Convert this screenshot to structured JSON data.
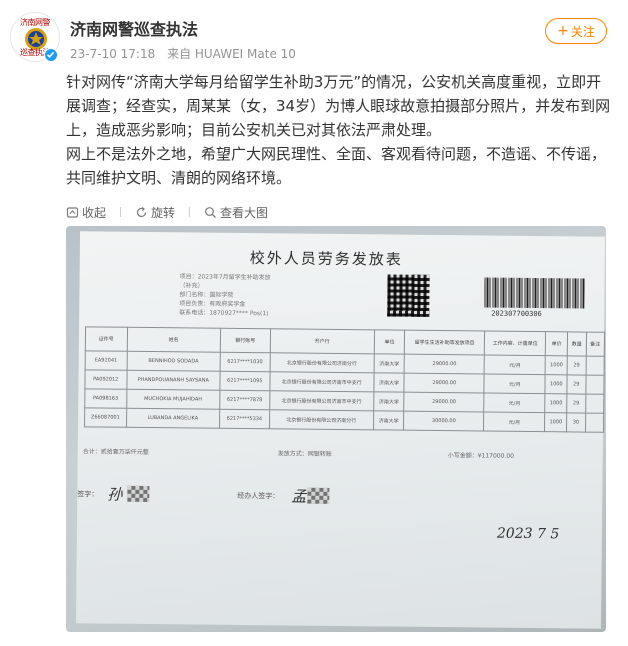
{
  "account": {
    "name": "济南网警巡查执法",
    "avatar_text_top": "济南网警",
    "avatar_text_bottom": "巡查执法",
    "timestamp": "23-7-10 17:18",
    "source": "来自 HUAWEI Mate 10",
    "follow_label": "关注",
    "verify_color": "#1e9cf0"
  },
  "post": {
    "paragraph1": "针对网传“济南大学每月给留学生补助3万元”的情况，公安机关高度重视，立即开展调查；经查实，周某某（女，34岁）为博人眼球故意拍摄部分照片，并发布到网上，造成恶劣影响；目前公安机关已对其依法严肃处理。",
    "paragraph2": "网上不是法外之地，希望广大网民理性、全面、客观看待问题，不造谣、不传谣，共同维护文明、清朗的网络环境。"
  },
  "image_toolbar": {
    "collect": "收起",
    "rotate": "旋转",
    "view_large": "查看大图"
  },
  "photo": {
    "doc_title": "校外人员劳务发放表",
    "info_lines": [
      "项目：2023年7月留学生补助发放",
      "（补充）",
      "部门名称：国际学院",
      "项目负责：有政府奖学金",
      "联系电话：1870927****  Pos(1)"
    ],
    "barcode_number": "202307700306",
    "table_headers": [
      "证件号",
      "姓名",
      "银行账号",
      "开户行",
      "单位",
      "留学生生活补助等发放项目",
      "工作内容、计量单位",
      "单价",
      "数量",
      "备注"
    ],
    "table_rows": [
      [
        "EA92041",
        "BENNIHOD SODADA",
        "6217****1030",
        "北京银行股份有限公司济南分行",
        "济南大学",
        "29000.00",
        "元/月",
        "1000",
        "29",
        ""
      ],
      [
        "PA092012",
        "PHANDPOUANANH SAYSANA",
        "6217****1095",
        "北京银行股份有限公司济南市中支行",
        "济南大学",
        "29000.00",
        "元/月",
        "1000",
        "29",
        ""
      ],
      [
        "PA098163",
        "MUCHOKIA MUJAHIDAH",
        "6217****7878",
        "北京银行股份有限公司济南市中支行",
        "济南大学",
        "29000.00",
        "元/月",
        "1000",
        "29",
        ""
      ],
      [
        "Z66087001",
        "LUBANDA ANGELIKA",
        "6217****5334",
        "北京银行股份有限公司济南分行",
        "济南大学",
        "30000.00",
        "元/月",
        "1000",
        "30",
        ""
      ]
    ],
    "footer_left": "合计：贰拾壹万柒仟元整",
    "footer_mid": "发放方式：网银转账",
    "footer_right": "小写金额：¥117000.00",
    "sig_label_left": "签字：",
    "sig_label_right": "经办人签字：",
    "signature_left": "孙",
    "signature_right": "孟",
    "handwritten_date": "2023 7 5"
  }
}
